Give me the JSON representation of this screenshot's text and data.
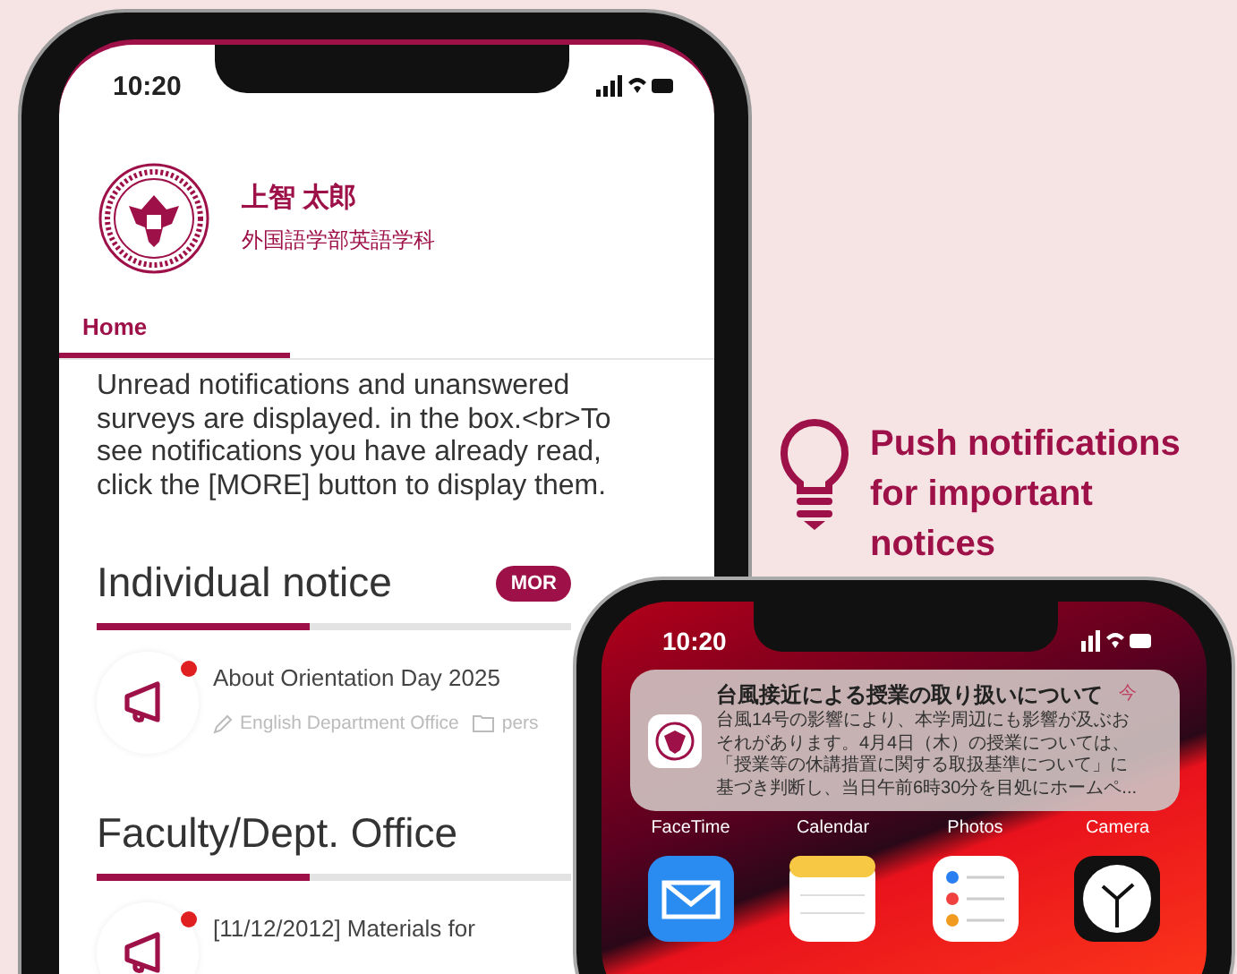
{
  "main_phone": {
    "status_bar": {
      "time": "10:20"
    },
    "profile": {
      "name": "上智 太郎",
      "department": "外国語学部英語学科"
    },
    "tabs": [
      {
        "label": "Home",
        "selected": true
      }
    ],
    "description": "Unread notifications and unanswered surveys are displayed. in the box.<br>To see notifications you have already read, click the [MORE] button to display them.",
    "sections": [
      {
        "title": "Individual notice",
        "more_button": "MOR",
        "level": 0.45,
        "items": [
          {
            "title": "About Orientation Day 2025",
            "unread": true,
            "sender": "English Department Office",
            "category": "pers"
          }
        ]
      },
      {
        "title": "Faculty/Dept. Office",
        "level": 0.45,
        "items": [
          {
            "title": "[11/12/2012] Materials for",
            "unread": true
          }
        ]
      }
    ]
  },
  "callout": {
    "text": "Push notifications for important notices"
  },
  "lock_phone": {
    "status_bar": {
      "time": "10:20"
    },
    "notification": {
      "title": "台風接近による授業の取り扱いについて",
      "time": "今",
      "body_lines": [
        "台風14号の影響により、本学周辺にも影響が及ぶお",
        "それがあります。4月4日（木）の授業については、",
        "「授業等の休講措置に関する取扱基準について」に",
        "基づき判断し、当日午前6時30分を目処にホームペ..."
      ]
    },
    "apps": [
      {
        "label": "FaceTime"
      },
      {
        "label": "Calendar"
      },
      {
        "label": "Photos"
      },
      {
        "label": "Camera"
      }
    ]
  }
}
